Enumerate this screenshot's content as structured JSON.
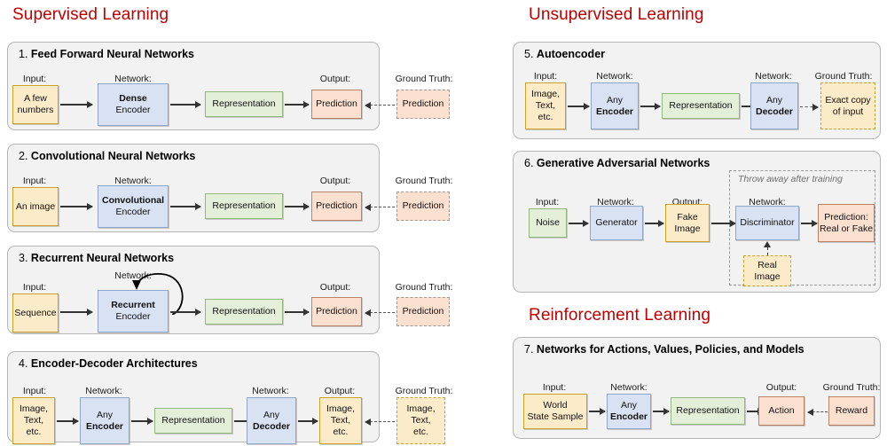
{
  "headings": [
    {
      "id": "supervised",
      "label": "Supervised Learning"
    },
    {
      "id": "unsupervised",
      "label": "Unsupervised Learning"
    },
    {
      "id": "reinforcement",
      "label": "Reinforcement Learning"
    }
  ],
  "colors": {
    "heading": "#c00000",
    "panel_bg": "#f2f2f2",
    "panel_border": "#b6b6b6",
    "input_yellow": "#fcebc8",
    "network_blue": "#d8e2f3",
    "representation_green": "#e3efd9",
    "output_orange": "#fbe0d0",
    "arrow": "#333333",
    "italic_note": "#6e6e6e"
  },
  "captions": {
    "input": "Input:",
    "network": "Network:",
    "output": "Output:",
    "ground_truth": "Ground Truth:"
  },
  "panels": [
    {
      "id": "feed-forward",
      "number": "1.",
      "title": "Feed Forward Neural Networks",
      "boxes": {
        "input": [
          "A few",
          "numbers"
        ],
        "network_bold": "Dense",
        "network_sub": "Encoder",
        "representation": "Representation",
        "output": "Prediction",
        "ground_truth": "Prediction"
      }
    },
    {
      "id": "convolutional",
      "number": "2.",
      "title": "Convolutional Neural Networks",
      "boxes": {
        "input": [
          "An image"
        ],
        "network_bold": "Convolutional",
        "network_sub": "Encoder",
        "representation": "Representation",
        "output": "Prediction",
        "ground_truth": "Prediction"
      }
    },
    {
      "id": "recurrent",
      "number": "3.",
      "title": "Recurrent Neural Networks",
      "boxes": {
        "input": [
          "Sequence"
        ],
        "network_bold": "Recurrent",
        "network_sub": "Encoder",
        "representation": "Representation",
        "output": "Prediction",
        "ground_truth": "Prediction"
      }
    },
    {
      "id": "encoder-decoder",
      "number": "4.",
      "title": "Encoder-Decoder Architectures",
      "boxes": {
        "input": [
          "Image,",
          "Text,",
          "etc."
        ],
        "encoder_sub": "Any",
        "encoder_bold": "Encoder",
        "representation": "Representation",
        "decoder_sub": "Any",
        "decoder_bold": "Decoder",
        "output": [
          "Image,",
          "Text,",
          "etc."
        ],
        "ground_truth": [
          "Image,",
          "Text,",
          "etc."
        ]
      }
    },
    {
      "id": "autoencoder",
      "number": "5.",
      "title": "Autoencoder",
      "boxes": {
        "input": [
          "Image,",
          "Text,",
          "etc."
        ],
        "encoder_sub": "Any",
        "encoder_bold": "Encoder",
        "representation": "Representation",
        "decoder_sub": "Any",
        "decoder_bold": "Decoder",
        "ground_truth": [
          "Exact copy",
          "of input"
        ]
      }
    },
    {
      "id": "gan",
      "number": "6.",
      "title": "Generative Adversarial Networks",
      "region_note": "Throw away after training",
      "boxes": {
        "input": "Noise",
        "generator": "Generator",
        "fake_image": [
          "Fake",
          "Image"
        ],
        "discriminator": "Discriminator",
        "prediction": [
          "Prediction:",
          "Real or Fake"
        ],
        "real_image": [
          "Real",
          "Image"
        ]
      }
    },
    {
      "id": "rl-networks",
      "number": "7.",
      "title": "Networks for Actions, Values, Policies, and Models",
      "boxes": {
        "input": [
          "World",
          "State Sample"
        ],
        "encoder_sub": "Any",
        "encoder_bold": "Encoder",
        "representation": "Representation",
        "output": "Action",
        "ground_truth": "Reward"
      }
    }
  ]
}
